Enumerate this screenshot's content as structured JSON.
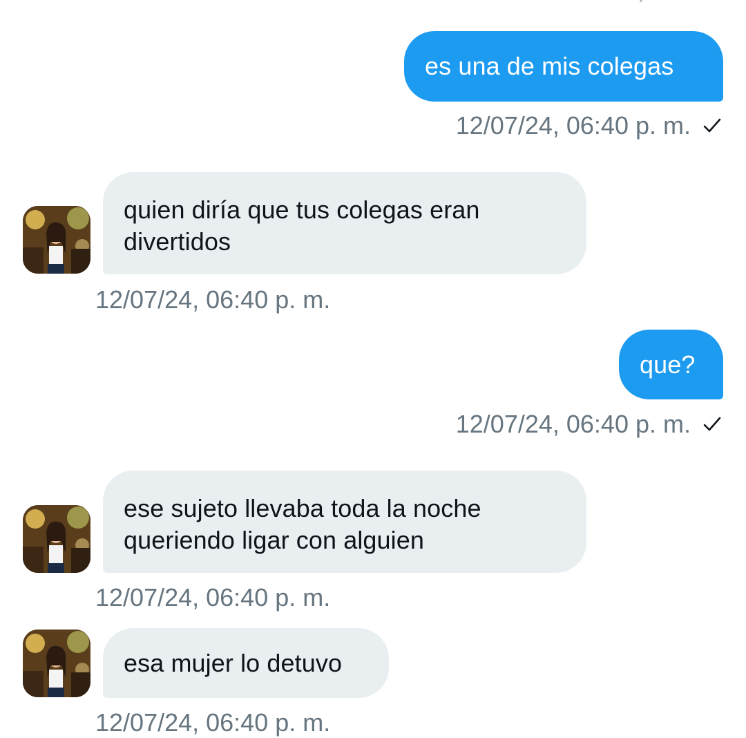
{
  "conversation": {
    "messages": [
      {
        "direction": "sent",
        "text": "es una de mis colegas",
        "time": "12/07/24, 06:40 p. m.",
        "read_icon": "check-icon"
      },
      {
        "direction": "received",
        "text": "quien diría que tus colegas eran divertidos",
        "time": "12/07/24, 06:40 p. m.",
        "avatar_icon": "avatar"
      },
      {
        "direction": "sent",
        "text": "que?",
        "time": "12/07/24, 06:40 p. m.",
        "read_icon": "check-icon"
      },
      {
        "direction": "received",
        "text": "ese sujeto llevaba toda la noche queriendo ligar con alguien",
        "time": "12/07/24, 06:40 p. m.",
        "avatar_icon": "avatar"
      },
      {
        "direction": "received",
        "text": "esa mujer lo detuvo",
        "time": "12/07/24, 06:40 p. m.",
        "avatar_icon": "avatar"
      }
    ]
  },
  "colors": {
    "sent_bubble": "#1d9bf0",
    "received_bubble": "#e9eef1",
    "timestamp": "#66757f",
    "background": "#ffffff"
  }
}
